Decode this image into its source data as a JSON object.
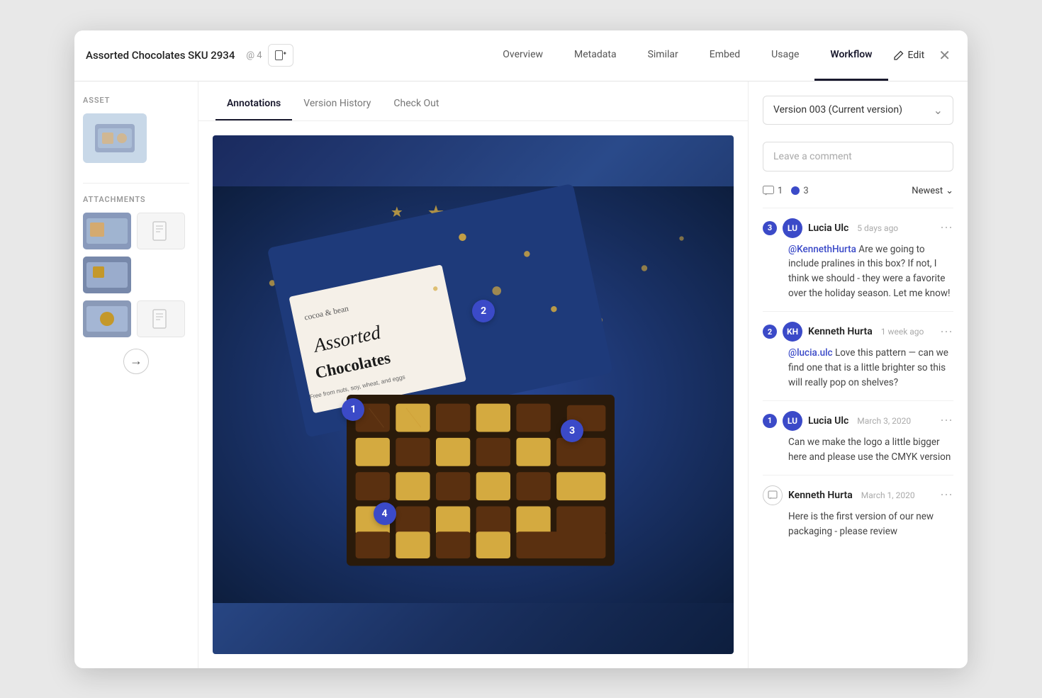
{
  "window": {
    "title": "Assorted Chocolates SKU 2934",
    "at_count": "@ 4"
  },
  "header_tabs": [
    {
      "id": "overview",
      "label": "Overview",
      "active": false
    },
    {
      "id": "metadata",
      "label": "Metadata",
      "active": false
    },
    {
      "id": "similar",
      "label": "Similar",
      "active": false
    },
    {
      "id": "embed",
      "label": "Embed",
      "active": false
    },
    {
      "id": "usage",
      "label": "Usage",
      "active": false
    },
    {
      "id": "workflow",
      "label": "Workflow",
      "active": true
    }
  ],
  "edit_label": "Edit",
  "sub_tabs": [
    {
      "id": "annotations",
      "label": "Annotations",
      "active": true
    },
    {
      "id": "version-history",
      "label": "Version History",
      "active": false
    },
    {
      "id": "check-out",
      "label": "Check Out",
      "active": false
    }
  ],
  "sidebar": {
    "asset_label": "ASSET",
    "attachments_label": "ATTACHMENTS"
  },
  "version_dropdown": {
    "label": "Version 003 (Current version)"
  },
  "comment_input_placeholder": "Leave a comment",
  "comments_header": {
    "count1": "1",
    "count2": "3",
    "sort_label": "Newest"
  },
  "annotations": [
    {
      "number": "1",
      "left": "27",
      "top": "53"
    },
    {
      "number": "2",
      "left": "52",
      "top": "36"
    },
    {
      "number": "3",
      "left": "69",
      "top": "59"
    },
    {
      "number": "4",
      "left": "33",
      "top": "72"
    }
  ],
  "comments": [
    {
      "id": 1,
      "number": "3",
      "author": "Lucia Ulc",
      "time": "5 days ago",
      "body_mention": "@KennethHurta",
      "body_text": " Are we going to include pralines in this box? If not, I think we should - they were a favorite over the holiday season. Let me know!",
      "avatar_initials": "LU"
    },
    {
      "id": 2,
      "number": "2",
      "author": "Kenneth Hurta",
      "time": "1 week ago",
      "body_mention": "@lucia.ulc",
      "body_text": " Love this pattern — can we find one that is a little brighter so this will really pop on shelves?",
      "avatar_initials": "KH"
    },
    {
      "id": 3,
      "number": "1",
      "author": "Lucia Ulc",
      "time": "March 3, 2020",
      "body_mention": "",
      "body_text": "Can we make the logo a little bigger here and please use the CMYK version",
      "avatar_initials": "LU"
    },
    {
      "id": 4,
      "number": "",
      "author": "Kenneth Hurta",
      "time": "March 1, 2020",
      "body_mention": "",
      "body_text": "Here is the first version of our new packaging - please review",
      "avatar_initials": "KH",
      "outline": true
    }
  ]
}
